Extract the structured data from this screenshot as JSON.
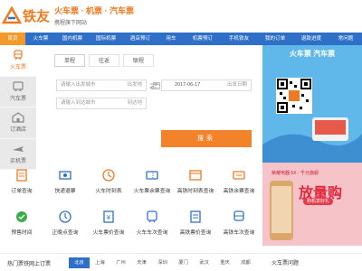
{
  "header": {
    "logo_text": "铁友",
    "tagline_main": "火车票 · 机票 · 汽车票",
    "tagline_sub": "携程旗下网站"
  },
  "nav": {
    "items": [
      {
        "label": "首页",
        "active": true
      },
      {
        "label": "火车票",
        "active": false
      },
      {
        "label": "国内机票",
        "active": false
      },
      {
        "label": "国际机票",
        "active": false
      },
      {
        "label": "酒店预订",
        "active": false
      },
      {
        "label": "用车",
        "active": false
      },
      {
        "label": "机票预订",
        "active": false
      },
      {
        "label": "手机铁友",
        "active": false
      },
      {
        "label": "我的订单",
        "active": false
      },
      {
        "label": "退款进度",
        "active": false
      },
      {
        "label": "常问题",
        "active": false
      }
    ]
  },
  "sidebar": {
    "tabs": [
      {
        "label": "火车票",
        "icon": "train-icon",
        "active": true
      },
      {
        "label": "汽车票",
        "icon": "bus-icon",
        "active": false
      },
      {
        "label": "订酒店",
        "icon": "hotel-icon",
        "active": false
      },
      {
        "label": "买机票",
        "icon": "plane-icon",
        "active": false
      }
    ]
  },
  "search": {
    "modes": [
      {
        "label": "单程",
        "active": true
      },
      {
        "label": "往返",
        "active": false
      },
      {
        "label": "联程",
        "active": false
      }
    ],
    "from_placeholder": "请输入出发城市",
    "from_hint": "出发地",
    "to_placeholder": "请输入到达城市",
    "to_hint": "到达地",
    "date_value": "2017-06-17",
    "date_hint": "出发日期",
    "button_label": "搜索"
  },
  "ad1": {
    "title": "火车票 汽车票"
  },
  "services": [
    {
      "label": "订单查询",
      "icon": "order-icon"
    },
    {
      "label": "快递退票",
      "icon": "refund-icon"
    },
    {
      "label": "火车时刻表",
      "icon": "timetable-icon"
    },
    {
      "label": "火车票余票查询",
      "icon": "ticket-remain-icon"
    },
    {
      "label": "高铁时刻表查询",
      "icon": "hs-timetable-icon"
    },
    {
      "label": "高铁余票查询",
      "icon": "hs-remain-icon"
    },
    {
      "label": "预售时间",
      "icon": "presale-icon"
    },
    {
      "label": "正晚点查询",
      "icon": "delay-icon"
    },
    {
      "label": "火车票价查询",
      "icon": "price-icon"
    },
    {
      "label": "火车车次查询",
      "icon": "train-no-icon"
    },
    {
      "label": "高铁票价查询",
      "icon": "hs-price-icon"
    },
    {
      "label": "高铁车次查询",
      "icon": "hs-train-no-icon"
    }
  ],
  "ad2": {
    "top": "荣耀电器 6X · 千元旗舰",
    "title": "放量购",
    "badge": "购机享好礼"
  },
  "bottom": {
    "hot_title": "热门票铁网上订票",
    "cities": [
      {
        "label": "北京",
        "active": true
      },
      {
        "label": "上海",
        "active": false
      },
      {
        "label": "广州",
        "active": false
      },
      {
        "label": "天津",
        "active": false
      },
      {
        "label": "深圳",
        "active": false
      },
      {
        "label": "厦门",
        "active": false
      },
      {
        "label": "武汉",
        "active": false
      },
      {
        "label": "重庆",
        "active": false
      },
      {
        "label": "成都",
        "active": false
      }
    ],
    "faq_title": "火车票问题"
  },
  "colors": {
    "brand_orange": "#f07a1f",
    "nav_blue": "#2e70c7",
    "button_orange": "#f3832a"
  }
}
